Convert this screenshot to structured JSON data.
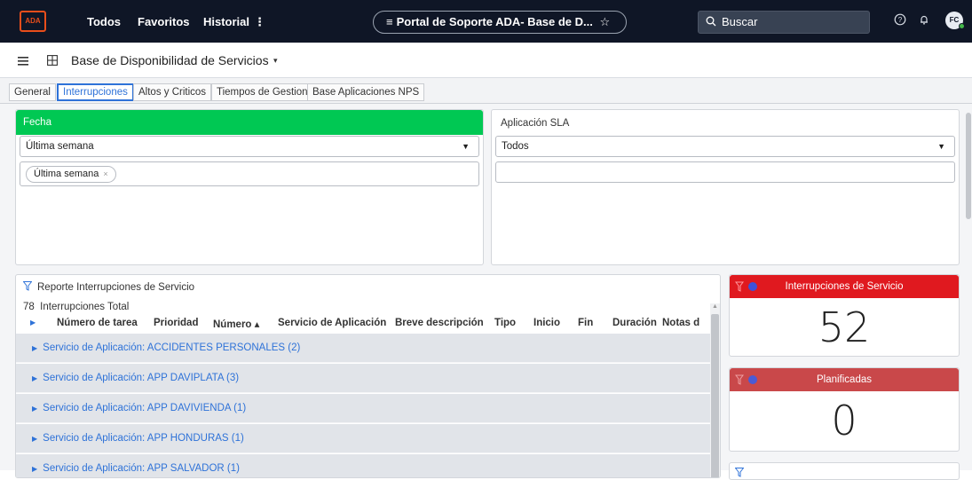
{
  "topbar": {
    "logo_text": "ADA",
    "nav": [
      "Todos",
      "Favoritos",
      "Historial"
    ],
    "more_glyph": "⋮",
    "portal_title": "Portal de Soporte ADA- Base de D...",
    "search_placeholder": "Buscar",
    "avatar_initials": "FC",
    "colors": {
      "bar": "#0f1626",
      "logo": "#e94e1b",
      "status": "#43b649"
    }
  },
  "page": {
    "title": "Base de Disponibilidad de Servicios",
    "title_caret": "▾"
  },
  "tabs": [
    {
      "label": "General",
      "active": false
    },
    {
      "label": "Interrupciones",
      "active": true
    },
    {
      "label": "Altos y Criticos",
      "active": false
    },
    {
      "label": "Tiempos de Gestion",
      "active": false
    },
    {
      "label": "Base Aplicaciones NPS",
      "active": false
    }
  ],
  "filters": {
    "fecha": {
      "header": "Fecha",
      "selected": "Última semana",
      "chip": "Última semana",
      "chip_close": "×",
      "header_color": "#00c853"
    },
    "aplicacion": {
      "header": "Aplicación SLA",
      "selected": "Todos"
    }
  },
  "report": {
    "title": "Reporte Interrupciones de Servicio",
    "total": "78  Interrupciones Total",
    "columns": [
      "Número de tarea",
      "Prioridad",
      "Número ▴",
      "Servicio de Aplicación",
      "Breve descripción",
      "Tipo",
      "Inicio",
      "Fin",
      "Duración",
      "Notas d"
    ],
    "groups": [
      "Servicio de Aplicación: ACCIDENTES PERSONALES (2)",
      "Servicio de Aplicación: APP DAVIPLATA (3)",
      "Servicio de Aplicación: APP DAVIVIENDA (1)",
      "Servicio de Aplicación: APP HONDURAS (1)",
      "Servicio de Aplicación: APP SALVADOR (1)"
    ]
  },
  "kpis": [
    {
      "title": "Interrupciones de Servicio",
      "value": "52",
      "color": "#e0191f"
    },
    {
      "title": "Planificadas",
      "value": "0",
      "color": "#c9484a"
    }
  ]
}
